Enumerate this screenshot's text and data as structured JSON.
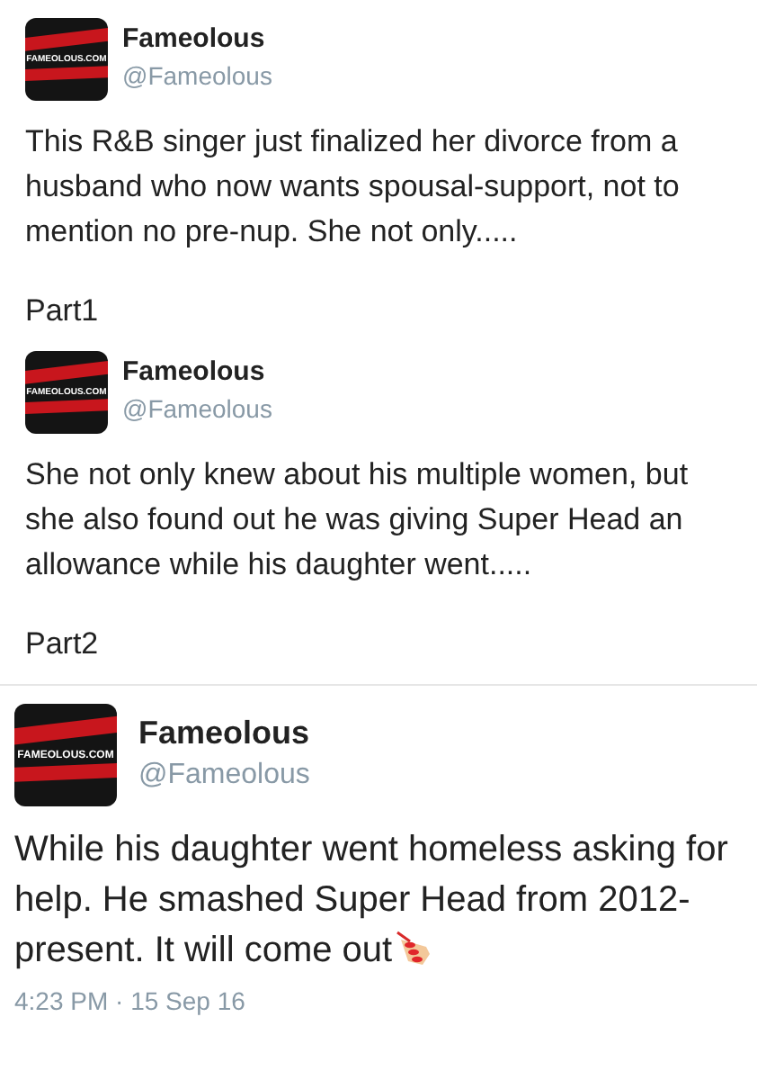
{
  "tweets": [
    {
      "kind": "quoted",
      "avatar_text": "FAMEOLOUS.COM",
      "name": "Fameolous",
      "handle": "@Fameolous",
      "text": "This R&B singer just finalized her divorce from a husband who now wants spousal-support, not to mention no pre-nup. She not only.....",
      "footer": "Part1"
    },
    {
      "kind": "quoted",
      "avatar_text": "FAMEOLOUS.COM",
      "name": "Fameolous",
      "handle": "@Fameolous",
      "text": "She not only knew about his multiple women, but she also found out he was giving Super Head an allowance while his daughter went.....",
      "footer": "Part2"
    },
    {
      "kind": "main",
      "avatar_text": "FAMEOLOUS.COM",
      "name": "Fameolous",
      "handle": "@Fameolous",
      "text": "While his daughter went homeless asking for help. He smashed Super Head from 2012-present. It will come out",
      "footer": "4:23 PM · 15 Sep 16"
    }
  ]
}
